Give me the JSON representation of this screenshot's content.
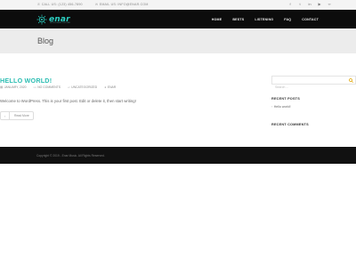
{
  "topbar": {
    "phone": "CALL US: (123) 456-7890",
    "email": "EMAIL US: INFO@ENAR.COM",
    "social": [
      {
        "icon": "facebook-icon",
        "glyph": "f"
      },
      {
        "icon": "twitter-icon",
        "glyph": "t"
      },
      {
        "icon": "linkedin-icon",
        "glyph": "in"
      },
      {
        "icon": "youtube-icon",
        "glyph": "▶"
      },
      {
        "icon": "tripadvisor-icon",
        "glyph": "∞"
      }
    ]
  },
  "header": {
    "logo_text": "enar",
    "logo_tagline": "INTELLIGENT FUTURE",
    "accent": "#2bd0c2",
    "nav": [
      {
        "label": "HOME"
      },
      {
        "label": "BESTS"
      },
      {
        "label": "LISTENING"
      },
      {
        "label": "FAQ"
      },
      {
        "label": "CONTACT"
      }
    ]
  },
  "page": {
    "title": "Blog"
  },
  "post": {
    "title": "HELLO WORLD!",
    "meta": [
      {
        "icon": "calendar-icon",
        "text": "JANUARY, 2020"
      },
      {
        "icon": "comment-icon",
        "text": "NO COMMENTS"
      },
      {
        "icon": "folder-icon",
        "text": "UNCATEGORIZED"
      },
      {
        "icon": "user-icon",
        "text": "ENAR"
      }
    ],
    "excerpt": "Welcome to WordPress. This is your first post. Edit or delete it, then start writing!",
    "read_more": "Read More"
  },
  "sidebar": {
    "search_placeholder": "Search ...",
    "recent_posts_title": "RECENT POSTS",
    "recent_posts": [
      "Hello world!"
    ],
    "recent_comments_title": "RECENT COMMENTS"
  },
  "footer": {
    "copyright": "Copyright © 2019 - Enar Music. All Rights Reserved."
  }
}
